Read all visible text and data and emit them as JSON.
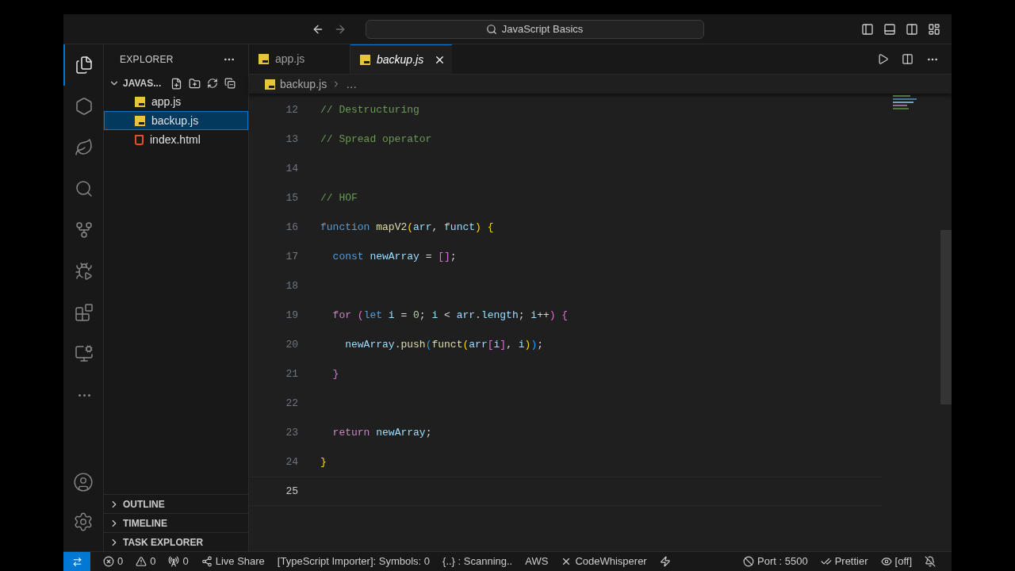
{
  "title_bar": {
    "search": "JavaScript Basics"
  },
  "activity_bar": {
    "top": [
      {
        "kind": "files",
        "selected": true
      },
      {
        "kind": "hexagon",
        "selected": false
      },
      {
        "kind": "leaf",
        "selected": false
      },
      {
        "kind": "search",
        "selected": false
      },
      {
        "kind": "source-control",
        "selected": false
      },
      {
        "kind": "run-debug",
        "selected": false
      },
      {
        "kind": "extensions",
        "selected": false
      },
      {
        "kind": "remote",
        "selected": false
      },
      {
        "kind": "more",
        "selected": false
      }
    ],
    "bottom": [
      {
        "kind": "account"
      },
      {
        "kind": "settings"
      }
    ]
  },
  "sidebar": {
    "title": "EXPLORER",
    "folder": {
      "name": "JAVAS...",
      "expanded": true,
      "children": [
        {
          "name": "app.js",
          "kind": "js",
          "selected": false
        },
        {
          "name": "backup.js",
          "kind": "js",
          "selected": true
        },
        {
          "name": "index.html",
          "kind": "html",
          "selected": false
        }
      ]
    },
    "sections": [
      {
        "label": "OUTLINE",
        "expanded": false
      },
      {
        "label": "TIMELINE",
        "expanded": false
      },
      {
        "label": "TASK EXPLORER",
        "expanded": false
      }
    ]
  },
  "tabs": [
    {
      "label": "app.js",
      "kind": "js",
      "selected": false
    },
    {
      "label": "backup.js",
      "kind": "js",
      "selected": true
    }
  ],
  "breadcrumb": {
    "file": "backup.js",
    "rest": "…"
  },
  "editor": {
    "lines": [
      {
        "number": "12",
        "tokens": [
          {
            "text": "// Destructuring",
            "kind": "comment"
          }
        ]
      },
      {
        "number": "13",
        "tokens": [
          {
            "text": "// Spread operator",
            "kind": "comment"
          }
        ]
      },
      {
        "number": "14"
      },
      {
        "number": "15",
        "tokens": [
          {
            "text": "// HOF",
            "kind": "comment"
          }
        ]
      },
      {
        "number": "16",
        "tokens": [
          {
            "text": "function",
            "kind": "keyword"
          },
          {
            "text": " mapV2",
            "kind": "function"
          },
          {
            "text": "(",
            "kind": "bracket1"
          },
          {
            "text": "arr",
            "kind": "variable"
          },
          {
            "text": ",",
            "kind": "plain"
          },
          {
            "text": " funct",
            "kind": "variable"
          },
          {
            "text": ")",
            "kind": "bracket1"
          },
          {
            "text": " {",
            "kind": "bracket1"
          }
        ]
      },
      {
        "number": "17",
        "tokens": [
          {
            "text": "  const",
            "kind": "keyword"
          },
          {
            "text": " newArray",
            "kind": "variable"
          },
          {
            "text": " = ",
            "kind": "plain"
          },
          {
            "text": "[]",
            "kind": "bracket2"
          },
          {
            "text": ";",
            "kind": "plain"
          }
        ]
      },
      {
        "number": "18"
      },
      {
        "number": "19",
        "tokens": [
          {
            "text": "  for",
            "kind": "control"
          },
          {
            "text": " (",
            "kind": "bracket2"
          },
          {
            "text": "let",
            "kind": "keyword"
          },
          {
            "text": " i",
            "kind": "variable"
          },
          {
            "text": " = ",
            "kind": "plain"
          },
          {
            "text": "0",
            "kind": "number"
          },
          {
            "text": "; ",
            "kind": "plain"
          },
          {
            "text": "i",
            "kind": "variable"
          },
          {
            "text": " < ",
            "kind": "plain"
          },
          {
            "text": "arr",
            "kind": "variable"
          },
          {
            "text": ".",
            "kind": "plain"
          },
          {
            "text": "length",
            "kind": "variable"
          },
          {
            "text": "; ",
            "kind": "plain"
          },
          {
            "text": "i",
            "kind": "variable"
          },
          {
            "text": "++",
            "kind": "plain"
          },
          {
            "text": ")",
            "kind": "bracket2"
          },
          {
            "text": " {",
            "kind": "bracket2"
          }
        ]
      },
      {
        "number": "20",
        "tokens": [
          {
            "text": "    newArray",
            "kind": "variable"
          },
          {
            "text": ".",
            "kind": "plain"
          },
          {
            "text": "push",
            "kind": "function"
          },
          {
            "text": "(",
            "kind": "bracket3"
          },
          {
            "text": "funct",
            "kind": "function"
          },
          {
            "text": "(",
            "kind": "bracket1"
          },
          {
            "text": "arr",
            "kind": "variable"
          },
          {
            "text": "[",
            "kind": "bracket2"
          },
          {
            "text": "i",
            "kind": "variable"
          },
          {
            "text": "]",
            "kind": "bracket2"
          },
          {
            "text": ", ",
            "kind": "plain"
          },
          {
            "text": "i",
            "kind": "variable"
          },
          {
            "text": ")",
            "kind": "bracket1"
          },
          {
            "text": ")",
            "kind": "bracket3"
          },
          {
            "text": ";",
            "kind": "plain"
          }
        ]
      },
      {
        "number": "21",
        "tokens": [
          {
            "text": "  }",
            "kind": "bracket2"
          }
        ]
      },
      {
        "number": "22"
      },
      {
        "number": "23",
        "tokens": [
          {
            "text": "  return",
            "kind": "control"
          },
          {
            "text": " newArray",
            "kind": "variable"
          },
          {
            "text": ";",
            "kind": "plain"
          }
        ]
      },
      {
        "number": "24",
        "tokens": [
          {
            "text": "}",
            "kind": "bracket1"
          }
        ]
      },
      {
        "number": "25",
        "current": true
      }
    ]
  },
  "status_bar": {
    "left": [
      {
        "kind": "remote"
      },
      {
        "kind": "errors",
        "text": "0"
      },
      {
        "kind": "warnings",
        "text": "0"
      },
      {
        "kind": "ports",
        "text": "0"
      },
      {
        "kind": "live-share",
        "text": "Live Share"
      },
      {
        "kind": "text",
        "text": "[TypeScript Importer]: Symbols: 0"
      },
      {
        "kind": "text",
        "text": "{..} : Scanning.."
      },
      {
        "kind": "text",
        "text": "AWS"
      },
      {
        "kind": "close",
        "text": "CodeWhisperer"
      },
      {
        "kind": "lightning"
      }
    ],
    "right": [
      {
        "kind": "port",
        "text": "Port : 5500"
      },
      {
        "kind": "prettier",
        "text": "Prettier"
      },
      {
        "kind": "eye",
        "text": "[off]"
      },
      {
        "kind": "bell-off"
      }
    ]
  }
}
